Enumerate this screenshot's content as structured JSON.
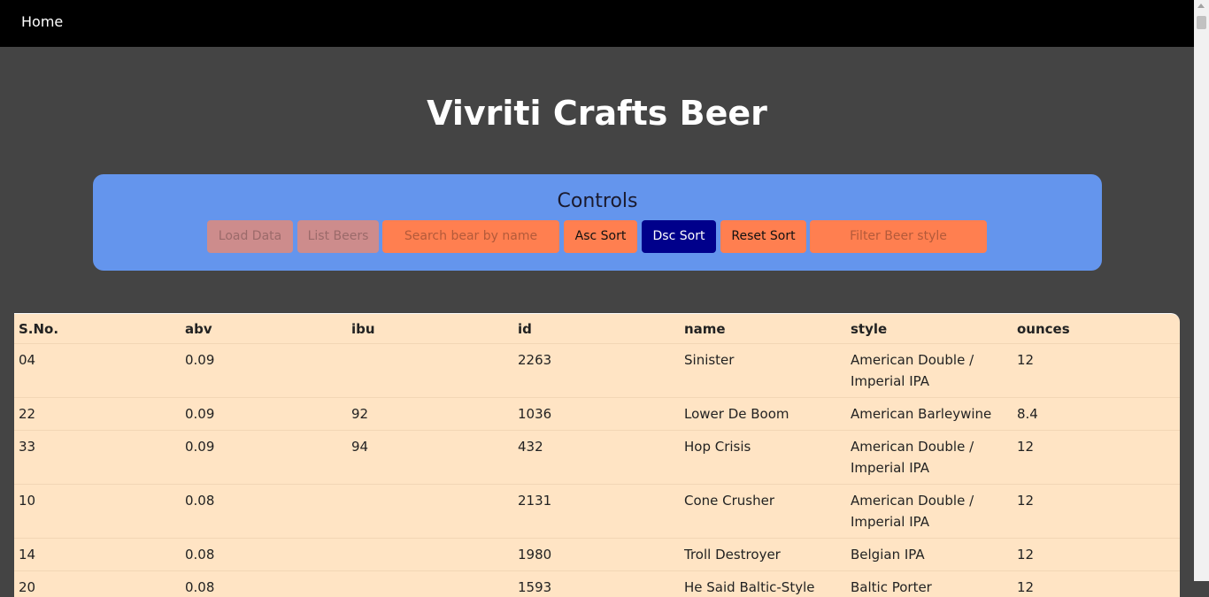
{
  "nav": {
    "home_label": "Home"
  },
  "page": {
    "title": "Vivriti Crafts Beer"
  },
  "controls": {
    "title": "Controls",
    "load_data_label": "Load Data",
    "list_beers_label": "List Beers",
    "search_placeholder": "Search bear by name",
    "asc_sort_label": "Asc Sort",
    "dsc_sort_label": "Dsc Sort",
    "reset_sort_label": "Reset Sort",
    "filter_placeholder": "Filter Beer style"
  },
  "table": {
    "headers": [
      "S.No.",
      "abv",
      "ibu",
      "id",
      "name",
      "style",
      "ounces"
    ],
    "rows": [
      [
        "04",
        "0.09",
        "",
        "2263",
        "Sinister",
        "American Double / Imperial IPA",
        "12"
      ],
      [
        "22",
        "0.09",
        "92",
        "1036",
        "Lower De Boom",
        "American Barleywine",
        "8.4"
      ],
      [
        "33",
        "0.09",
        "94",
        "432",
        "Hop Crisis",
        "American Double / Imperial IPA",
        "12"
      ],
      [
        "10",
        "0.08",
        "",
        "2131",
        "Cone Crusher",
        "American Double / Imperial IPA",
        "12"
      ],
      [
        "14",
        "0.08",
        "",
        "1980",
        "Troll Destroyer",
        "Belgian IPA",
        "12"
      ],
      [
        "20",
        "0.08",
        "",
        "1593",
        "He Said Baltic-Style",
        "Baltic Porter",
        "12"
      ]
    ]
  },
  "colors": {
    "navbar": "#000000",
    "background": "#444444",
    "controls_panel": "#6495ed",
    "button_orange": "#ff7f50",
    "button_active": "#00008b",
    "table_bg": "#ffe4c4"
  }
}
